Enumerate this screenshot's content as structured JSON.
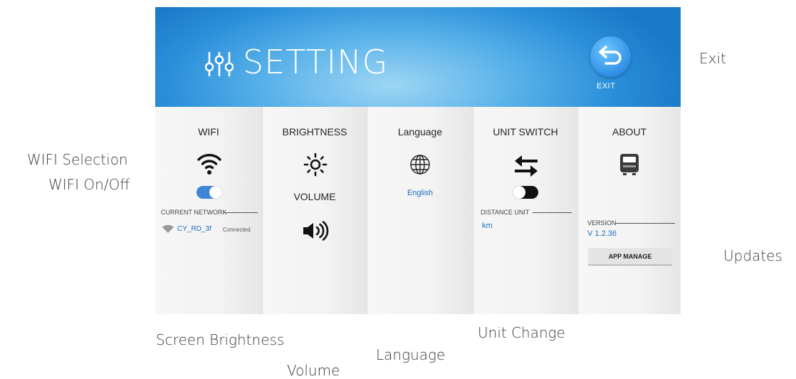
{
  "annotations": {
    "wifi_selection": "WIFI Selection",
    "wifi_onoff": "WIFI On/Off",
    "exit": "Exit",
    "updates": "Updates",
    "screen_brightness": "Screen Brightness",
    "volume": "Volume",
    "language": "Language",
    "unit_change": "Unit Change"
  },
  "header": {
    "title": "SETTING",
    "exit_label": "EXIT",
    "gradient_color": "#2a8fd9",
    "icon": "sliders-icon"
  },
  "panels": {
    "wifi": {
      "title": "WIFI",
      "icon": "wifi-icon",
      "toggle_on": true,
      "current_network_label": "CURRENT NETWORK",
      "network_name": "CY_RD_3f",
      "network_status": "Connected"
    },
    "brightness": {
      "title": "BRIGHTNESS",
      "icon": "sun-icon",
      "volume_title": "VOLUME",
      "volume_icon": "speaker-icon"
    },
    "language": {
      "title": "Language",
      "icon": "globe-icon",
      "value": "English"
    },
    "unit_switch": {
      "title": "UNIT SWITCH",
      "icon": "swap-arrows-icon",
      "toggle_on": false,
      "distance_unit_label": "DISTANCE UNIT",
      "distance_unit_value": "km"
    },
    "about": {
      "title": "ABOUT",
      "icon": "device-icon",
      "version_label": "VERSION",
      "version_value": "V 1.2.36",
      "app_manage_label": "APP MANAGE"
    }
  },
  "colors": {
    "accent": "#1a6fc1",
    "toggle_on": "#3d86d8",
    "toggle_off": "#111111"
  }
}
